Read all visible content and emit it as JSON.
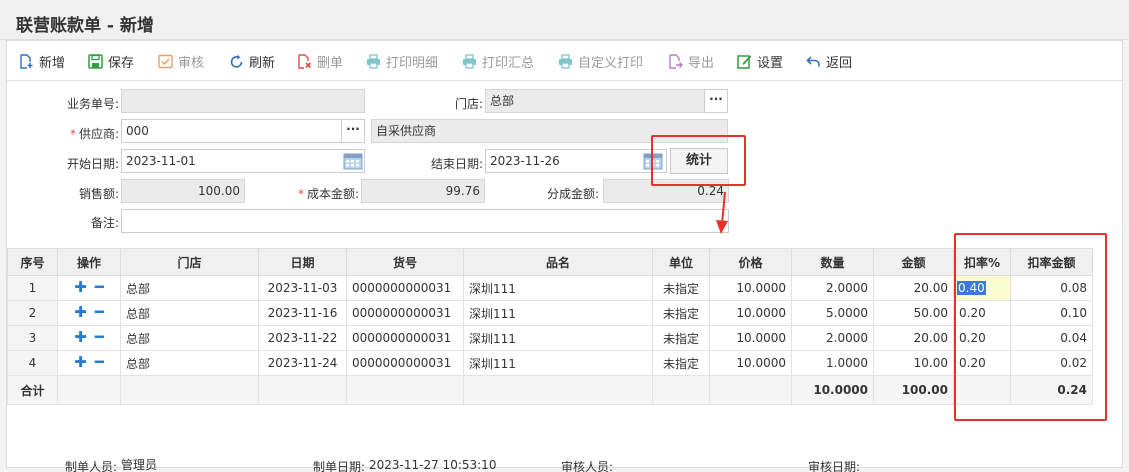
{
  "window": {
    "title": "联营账款单 - 新增"
  },
  "toolbar": {
    "add": "新增",
    "save": "保存",
    "audit": "审核",
    "refresh": "刷新",
    "delete": "删单",
    "print_detail": "打印明细",
    "print_summary": "打印汇总",
    "custom_print": "自定义打印",
    "export": "导出",
    "settings": "设置",
    "back": "返回"
  },
  "form": {
    "order_no_label": "业务单号:",
    "order_no": "",
    "store_label": "门店:",
    "store": "总部",
    "supplier_label": "供应商:",
    "supplier_code": "000",
    "supplier_name": "自采供应商",
    "start_date_label": "开始日期:",
    "start_date": "2023-11-01",
    "end_date_label": "结束日期:",
    "end_date": "2023-11-26",
    "stat_button": "统计",
    "sales_label": "销售额:",
    "sales": "100.00",
    "cost_label": "成本金额:",
    "cost": "99.76",
    "share_label": "分成金额:",
    "share": "0.24",
    "remark_label": "备注:",
    "remark": ""
  },
  "grid": {
    "columns": [
      "序号",
      "操作",
      "门店",
      "日期",
      "货号",
      "品名",
      "单位",
      "价格",
      "数量",
      "金额",
      "扣率%",
      "扣率金额"
    ],
    "rows": [
      {
        "no": "1",
        "store": "总部",
        "date": "2023-11-03",
        "sku": "0000000000031",
        "name": "深圳111",
        "unit": "未指定",
        "price": "10.0000",
        "qty": "2.0000",
        "amount": "20.00",
        "rate": "0.40",
        "rate_amount": "0.08"
      },
      {
        "no": "2",
        "store": "总部",
        "date": "2023-11-16",
        "sku": "0000000000031",
        "name": "深圳111",
        "unit": "未指定",
        "price": "10.0000",
        "qty": "5.0000",
        "amount": "50.00",
        "rate": "0.20",
        "rate_amount": "0.10"
      },
      {
        "no": "3",
        "store": "总部",
        "date": "2023-11-22",
        "sku": "0000000000031",
        "name": "深圳111",
        "unit": "未指定",
        "price": "10.0000",
        "qty": "2.0000",
        "amount": "20.00",
        "rate": "0.20",
        "rate_amount": "0.04"
      },
      {
        "no": "4",
        "store": "总部",
        "date": "2023-11-24",
        "sku": "0000000000031",
        "name": "深圳111",
        "unit": "未指定",
        "price": "10.0000",
        "qty": "1.0000",
        "amount": "10.00",
        "rate": "0.20",
        "rate_amount": "0.02"
      }
    ],
    "total": {
      "label": "合计",
      "qty": "10.0000",
      "amount": "100.00",
      "rate_amount": "0.24"
    }
  },
  "footer": {
    "creator_label": "制单人员:",
    "creator": "管理员",
    "created_label": "制单日期:",
    "created": "2023-11-27 10:53:10",
    "auditor_label": "审核人员:",
    "auditor": "",
    "audit_date_label": "审核日期:",
    "audit_date": ""
  },
  "colors": {
    "accent": "#2979d6",
    "highlight": "#e8302c",
    "edit_bg": "#fdfbd0",
    "selection": "#3d78d8"
  }
}
